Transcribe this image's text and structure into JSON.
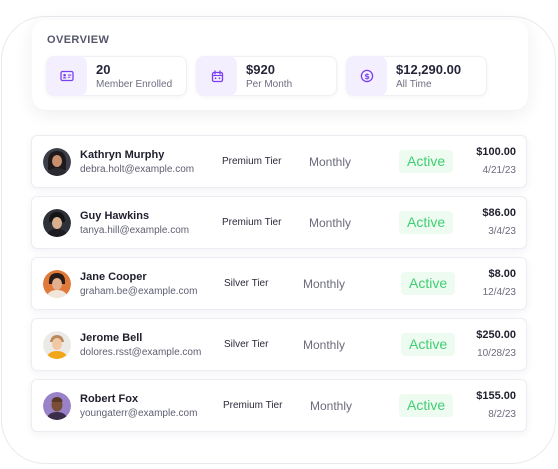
{
  "overview": {
    "title": "OVERVIEW",
    "stats": [
      {
        "value": "20",
        "label": "Member Enrolled",
        "icon": "id-card-icon"
      },
      {
        "value": "$920",
        "label": "Per Month",
        "icon": "calendar-icon"
      },
      {
        "value": "$12,290.00",
        "label": "All Time",
        "icon": "dollar-coin-icon"
      }
    ]
  },
  "colors": {
    "accent": "#7b3ff2",
    "icon_bg": "#f3efff",
    "active_text": "#3fcf72",
    "active_bg": "#eefbf1"
  },
  "members": [
    {
      "name": "Kathryn Murphy",
      "email": "debra.holt@example.com",
      "tier": "Premium Tier",
      "period": "Monthly",
      "status": "Active",
      "amount": "$100.00",
      "date": "4/21/23"
    },
    {
      "name": "Guy Hawkins",
      "email": "tanya.hill@example.com",
      "tier": "Premium Tier",
      "period": "Monthly",
      "status": "Active",
      "amount": "$86.00",
      "date": "3/4/23"
    },
    {
      "name": "Jane Cooper",
      "email": "graham.be@example.com",
      "tier": "Silver Tier",
      "period": "Monthly",
      "status": "Active",
      "amount": "$8.00",
      "date": "12/4/23"
    },
    {
      "name": "Jerome Bell",
      "email": "dolores.rsst@example.com",
      "tier": "Silver Tier",
      "period": "Monthly",
      "status": "Active",
      "amount": "$250.00",
      "date": "10/28/23"
    },
    {
      "name": "Robert Fox",
      "email": "youngaterr@example.com",
      "tier": "Premium Tier",
      "period": "Monthly",
      "status": "Active",
      "amount": "$155.00",
      "date": "8/2/23"
    }
  ]
}
